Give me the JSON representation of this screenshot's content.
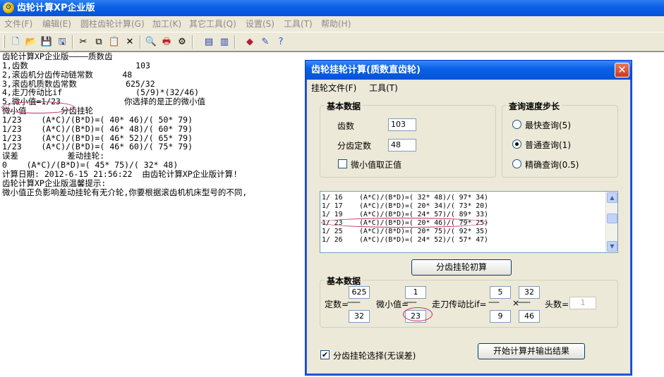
{
  "window": {
    "title": "齿轮计算XP企业版"
  },
  "menu": [
    "文件(F)",
    "编辑(E)",
    "圆柱齿轮计算(G)",
    "加工(K)",
    "其它工具(Q)",
    "设置(S)",
    "工具(T)",
    "帮助(H)"
  ],
  "toolbar_icons": [
    "new-file-icon",
    "open-folder-icon",
    "save-icon",
    "save-all-icon",
    "cut-icon",
    "copy-icon",
    "paste-icon",
    "delete-icon",
    "print-preview-icon",
    "print-icon",
    "settings-icon",
    "calculator-icon",
    "export-icon",
    "gem-icon",
    "pencil-icon",
    "help-icon"
  ],
  "editor": {
    "lines": [
      "齿轮计算XP企业版————质数齿",
      "1,齿数                      103",
      "2,滚齿机分齿传动链常数      48",
      "3,滚齿机质数齿常数          625/32",
      "4,走刀传动比if               (5/9)*(32/46)",
      "5,微小值=1/23             你选择的是正的微小值",
      "微小值       分齿挂轮",
      "1/23    (A*C)/(B*D)=( 40* 46)/( 50* 79)",
      "1/23    (A*C)/(B*D)=( 46* 48)/( 60* 79)",
      "1/23    (A*C)/(B*D)=( 46* 52)/( 65* 79)",
      "1/23    (A*C)/(B*D)=( 46* 60)/( 75* 79)",
      "误差          差动挂轮:",
      "0    (A*C)/(B*D)=( 45* 75)/( 32* 48)",
      "计算日期: 2012-6-15 21:56:22  由齿轮计算XP企业版计算!",
      "齿轮计算XP企业版温馨提示:",
      "微小值正负影响差动挂轮有无介轮,你要根据滚齿机机床型号的不同,"
    ]
  },
  "dialog": {
    "title": "齿轮挂轮计算(质数直齿轮)",
    "menu": [
      "挂轮文件(F)",
      "工具(T)"
    ],
    "basic": {
      "title": "基本数据",
      "teeth_label": "齿数",
      "teeth_value": "103",
      "index_label": "分齿定数",
      "index_value": "48",
      "positive_label": "微小值取正值",
      "positive_checked": false
    },
    "speed": {
      "title": "查询速度步长",
      "options": [
        "最快查询(5)",
        "普通查询(1)",
        "精确查询(0.5)"
      ],
      "selected": 1
    },
    "list_rows": [
      "1/ 16    (A*C)/(B*D)=( 32* 48)/( 97* 34)",
      "1/ 17    (A*C)/(B*D)=( 20* 34)/( 73* 20)",
      "1/ 19    (A*C)/(B*D)=( 24* 57)/( 89* 33)",
      "1/ 23    (A*C)/(B*D)=( 20* 46)/( 79* 25)",
      "1/ 25    (A*C)/(B*D)=( 20* 75)/( 92* 35)",
      "1/ 26    (A*C)/(B*D)=( 24* 52)/( 57* 47)"
    ],
    "calc_button": "分齿挂轮初算",
    "basic2": {
      "title": "基本数据",
      "const_label": "定数=",
      "const_num": "625",
      "const_den": "32",
      "small_label": "微小值=",
      "small_num": "1",
      "small_den": "23",
      "feed_label": "走刀传动比if=",
      "feed_a_num": "5",
      "feed_a_den": "9",
      "times": "×",
      "feed_b_num": "32",
      "feed_b_den": "46",
      "head_label": "头数=",
      "head_value": "1"
    },
    "select_label": "分齿挂轮选择(无误差)",
    "select_checked": true,
    "start_button": "开始计算并输出结果"
  },
  "colors": {
    "title_blue": "#0a5fe6",
    "highlight_oval": "#c0306a"
  }
}
